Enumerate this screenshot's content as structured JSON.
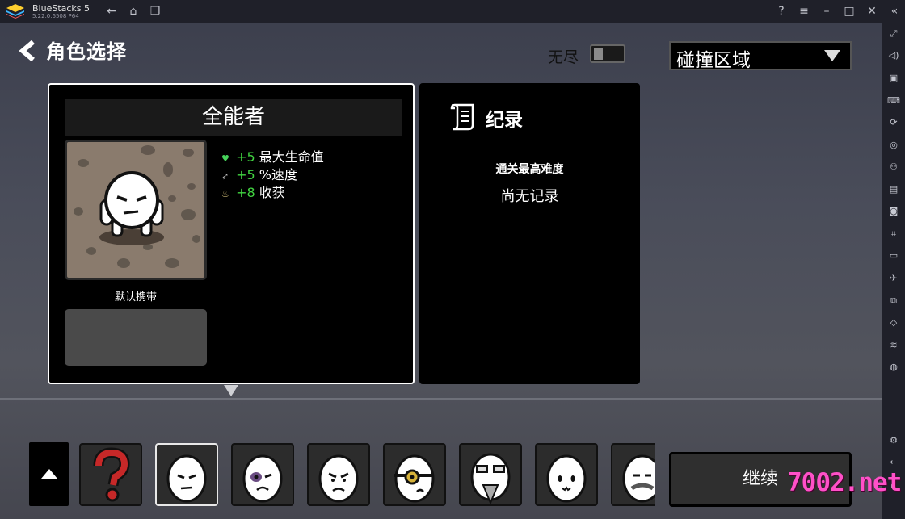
{
  "window": {
    "app_name": "BlueStacks 5",
    "app_version": "5.22.0.6508  P64",
    "nav_icons": [
      "back-arrow-icon",
      "home-icon",
      "multi-window-icon"
    ],
    "controls": [
      "help-icon",
      "menu-icon",
      "minimize-icon",
      "maximize-icon",
      "close-icon",
      "collapse-icon"
    ]
  },
  "sidebar": {
    "icons": [
      "fullscreen-icon",
      "volume-icon",
      "screen-record-icon",
      "keyboard-icon",
      "rotate-play-icon",
      "macro-icon",
      "gamepad-icon",
      "apk-icon",
      "screenshot-icon",
      "crop-icon",
      "folder-icon",
      "airplane-icon",
      "multi-instance-icon",
      "eco-icon",
      "layers-icon",
      "location-icon",
      "settings-icon",
      "back-icon",
      "home-icon"
    ]
  },
  "header": {
    "back_label": "角色选择",
    "endless_label": "无尽",
    "endless_on": false,
    "dropdown_value": "碰撞区域"
  },
  "character": {
    "name": "全能者",
    "stats": [
      {
        "icon": "heart-icon",
        "value": "+5",
        "label": "最大生命值",
        "color": "#41d441"
      },
      {
        "icon": "speed-icon",
        "value": "+5",
        "label": "%速度",
        "color": "#41d441"
      },
      {
        "icon": "harvest-icon",
        "value": "+8",
        "label": "收获",
        "color": "#41d441"
      }
    ],
    "default_carry_label": "默认携带"
  },
  "record": {
    "title": "纪录",
    "subtitle": "通关最高难度",
    "value": "尚无记录"
  },
  "roster": {
    "tiles": [
      "random-character-icon",
      "allrounder-face-icon",
      "bruised-face-icon",
      "grumpy-face-icon",
      "monocle-face-icon",
      "bearded-face-icon",
      "cute-face-icon",
      "mustache-face-icon"
    ],
    "selected_index": 1
  },
  "continue_label": "继续",
  "watermark": "7002.net"
}
